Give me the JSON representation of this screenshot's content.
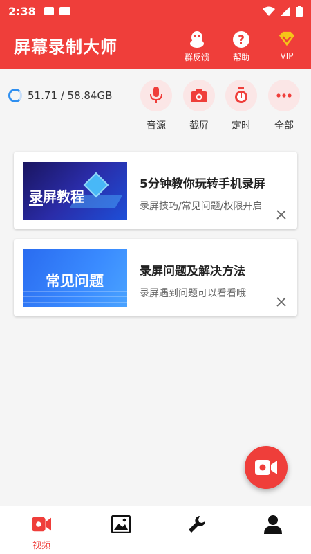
{
  "status_bar": {
    "time": "2:38",
    "icons": [
      "a-letter-icon",
      "video-icon",
      "wifi-icon",
      "signal-icon",
      "battery-icon"
    ]
  },
  "header": {
    "title": "屏幕录制大师",
    "actions": [
      {
        "label": "群反馈",
        "icon": "penguin-icon"
      },
      {
        "label": "帮助",
        "icon": "question-icon"
      },
      {
        "label": "VIP",
        "icon": "diamond-icon"
      }
    ]
  },
  "storage": {
    "text": "51.71 / 58.84GB"
  },
  "tools": [
    {
      "label": "音源",
      "icon": "microphone-icon"
    },
    {
      "label": "截屏",
      "icon": "camera-icon"
    },
    {
      "label": "定时",
      "icon": "stopwatch-icon"
    },
    {
      "label": "全部",
      "icon": "more-icon"
    }
  ],
  "cards": [
    {
      "thumb_text": "录屏教程",
      "title": "5分钟教你玩转手机录屏",
      "subtitle": "录屏技巧/常见问题/权限开启"
    },
    {
      "thumb_text": "常见问题",
      "title": "录屏问题及解决方法",
      "subtitle": "录屏遇到问题可以看看哦"
    }
  ],
  "tabs": [
    {
      "label": "视频",
      "icon": "video-tab-icon",
      "active": true
    },
    {
      "label": "",
      "icon": "image-icon",
      "active": false
    },
    {
      "label": "",
      "icon": "wrench-icon",
      "active": false
    },
    {
      "label": "",
      "icon": "person-icon",
      "active": false
    }
  ],
  "colors": {
    "accent": "#ef3e3a",
    "tool_bg": "#fbe6e6",
    "ring": "#2f8ff0",
    "vip_gold": "#f5c518"
  }
}
